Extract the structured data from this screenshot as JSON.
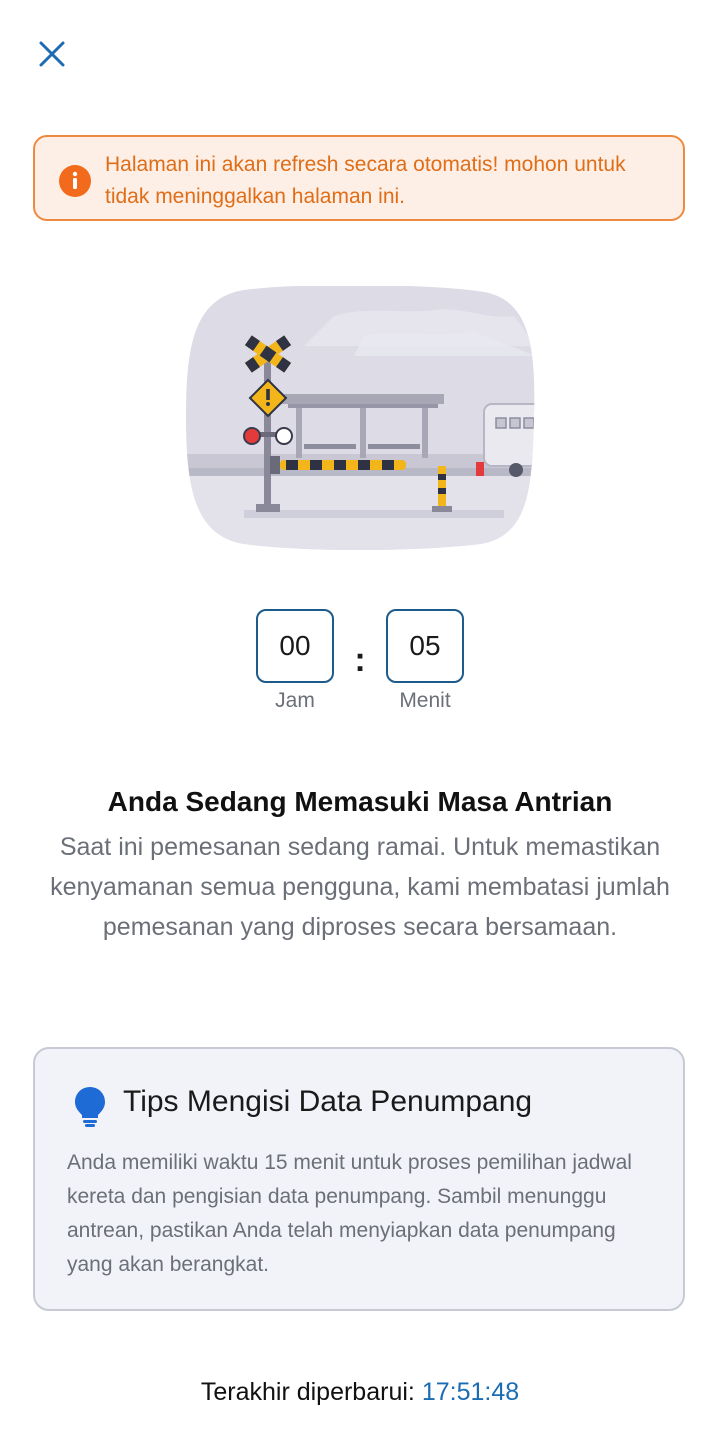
{
  "header": {
    "close_icon": "close-icon"
  },
  "alert": {
    "icon": "info-icon",
    "text": "Halaman ini akan refresh secara otomatis! mohon untuk tidak meninggalkan halaman ini.",
    "accent_color": "#ee8a3f"
  },
  "illustration": {
    "name": "railway-crossing-illustration"
  },
  "timer": {
    "hours_value": "00",
    "hours_label": "Jam",
    "separator": ":",
    "minutes_value": "05",
    "minutes_label": "Menit",
    "box_color": "#1e5b8a"
  },
  "queue": {
    "title": "Anda Sedang Memasuki Masa Antrian",
    "description": "Saat ini pemesanan sedang ramai. Untuk memastikan kenyamanan semua pengguna, kami membatasi jumlah pemesanan yang diproses secara bersamaan."
  },
  "tips": {
    "icon": "lightbulb-icon",
    "title": "Tips Mengisi Data Penumpang",
    "body": "Anda memiliki waktu 15 menit untuk proses pemilihan jadwal kereta dan pengisian data penumpang. Sambil menunggu antrean, pastikan Anda telah menyiapkan data penumpang yang akan berangkat."
  },
  "footer": {
    "label": "Terakhir diperbarui:",
    "time": "17:51:48",
    "time_color": "#1a6cb3"
  }
}
